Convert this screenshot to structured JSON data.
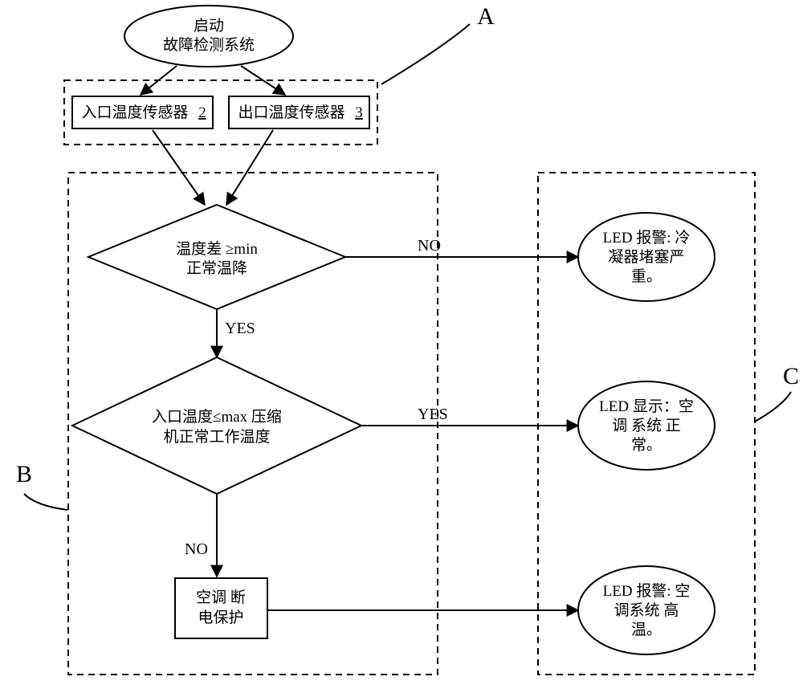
{
  "start": {
    "line1": "启动",
    "line2": "故障检测系统"
  },
  "sensorInRaw": "入口温度传感器",
  "sensorInNum": "2",
  "sensorOutRaw": "出口温度传感器",
  "sensorOutNum": "3",
  "dec1": {
    "line1": "温度差 ≥min",
    "line2": "正常温降"
  },
  "dec2": {
    "line1": "入口温度≤max 压缩",
    "line2": "机正常工作温度"
  },
  "protect": {
    "line1": "空调  断",
    "line2": "电保护"
  },
  "out1": {
    "line1": "LED 报警: 冷",
    "line2": "凝器堵塞严",
    "line3": "重。"
  },
  "out2": {
    "line1": "LED 显示：空",
    "line2": "调 系统 正",
    "line3": "常。"
  },
  "out3": {
    "line1": "LED 报警: 空",
    "line2": "调系统   高",
    "line3": "温。"
  },
  "label": {
    "yes": "YES",
    "no": "NO",
    "A": "A",
    "B": "B",
    "C": "C"
  }
}
